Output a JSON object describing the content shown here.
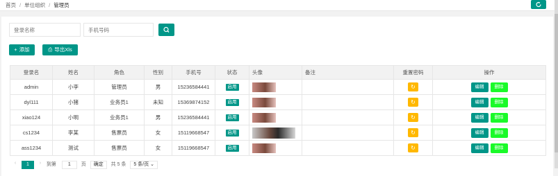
{
  "breadcrumb": {
    "items": [
      "首页",
      "单位组织",
      "管理员"
    ],
    "separator": "/"
  },
  "header": {
    "refresh_icon": "refresh-icon"
  },
  "search": {
    "login_placeholder": "登录名称",
    "phone_placeholder": "手机号码",
    "search_icon": "search-icon"
  },
  "toolbar": {
    "add_label": "添加",
    "export_label": "导出Xls"
  },
  "table": {
    "columns": [
      "登录名",
      "姓名",
      "角色",
      "性别",
      "手机号",
      "状态",
      "头像",
      "备注",
      "重置密码",
      "操作"
    ],
    "rows": [
      {
        "login": "admin",
        "name": "小李",
        "role": "管理员",
        "gender": "男",
        "phone": "15236584441",
        "status": "启用",
        "remark": ""
      },
      {
        "login": "dyl111",
        "name": "小猪",
        "role": "业务员1",
        "gender": "未知",
        "phone": "15369874152",
        "status": "启用",
        "remark": ""
      },
      {
        "login": "xiao124",
        "name": "小明",
        "role": "业务员1",
        "gender": "男",
        "phone": "15236584441",
        "status": "启用",
        "remark": ""
      },
      {
        "login": "cs1234",
        "name": "李某",
        "role": "售票员",
        "gender": "女",
        "phone": "15119668547",
        "status": "启用",
        "remark": ""
      },
      {
        "login": "ass1234",
        "name": "测试",
        "role": "售票员",
        "gender": "女",
        "phone": "15119668547",
        "status": "启用",
        "remark": ""
      }
    ],
    "edit_label": "编辑",
    "delete_label": "删除"
  },
  "pager": {
    "current": "1",
    "goto_label": "到第",
    "page_input": "1",
    "page_unit": "页",
    "confirm_label": "确定",
    "total_label": "共 5 条",
    "page_size_label": "5 条/页"
  },
  "colors": {
    "primary": "#009688",
    "warning": "#ffb800",
    "danger": "#1afa29"
  }
}
